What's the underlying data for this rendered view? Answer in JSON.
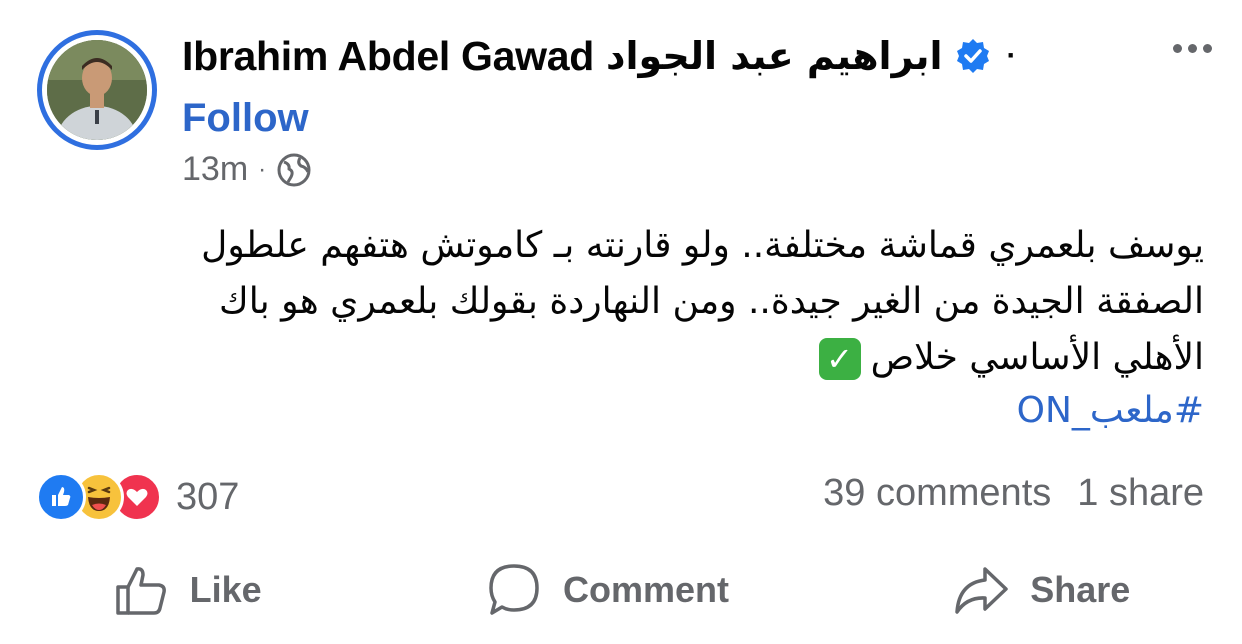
{
  "post": {
    "author_en": "Ibrahim Abdel Gawad",
    "author_ar": "ابراهيم  عبد  الجواد",
    "dot": "·",
    "follow_label": "Follow",
    "time": "13m",
    "meta_dot": "·",
    "text_lines": [
      "يوسف بلعمري قماشة مختلفة.. ولو قارنته بـ كاموتش هتفهم علطول",
      "الصفقة الجيدة من الغير جيدة.. ومن النهاردة بقولك بلعمري هو باك",
      "الأهلي الأساسي خلاص"
    ],
    "check_emoji": "✓",
    "hashtag": "#ملعب_ON"
  },
  "reactions": {
    "types": [
      "like-icon",
      "haha-icon",
      "love-icon"
    ],
    "count": "307"
  },
  "counts": {
    "comments": "39 comments",
    "shares": "1 share"
  },
  "actions": {
    "like_label": "Like",
    "comment_label": "Comment",
    "share_label": "Share"
  },
  "colors": {
    "accent": "#2d66c9",
    "ring": "#2f6fe0",
    "muted": "#65676b",
    "like": "#1f7bf2",
    "love": "#f0334f",
    "haha": "#f7c23c"
  }
}
